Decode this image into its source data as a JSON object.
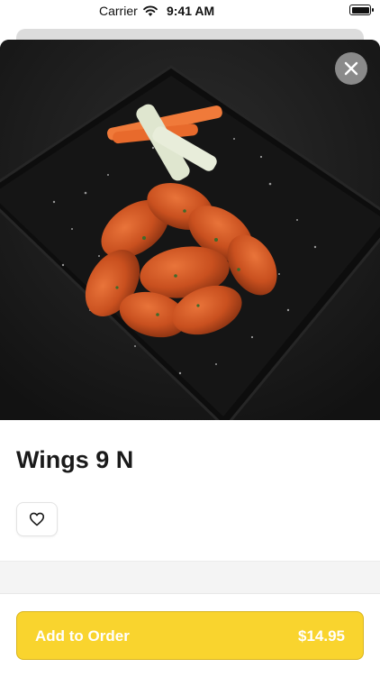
{
  "status_bar": {
    "carrier": "Carrier",
    "time": "9:41 AM"
  },
  "item": {
    "title": "Wings 9 N",
    "image_subject": "buffalo chicken wings with celery and carrot sticks on a dark slate board"
  },
  "actions": {
    "close_icon": "close-icon",
    "favorite_icon": "heart-outline-icon"
  },
  "order": {
    "label": "Add to Order",
    "price": "$14.95"
  },
  "colors": {
    "accent": "#f9d42e",
    "accent_border": "#d9b41a",
    "close_button": "#8a8a8a",
    "hero_background": "#1b1b1b"
  }
}
